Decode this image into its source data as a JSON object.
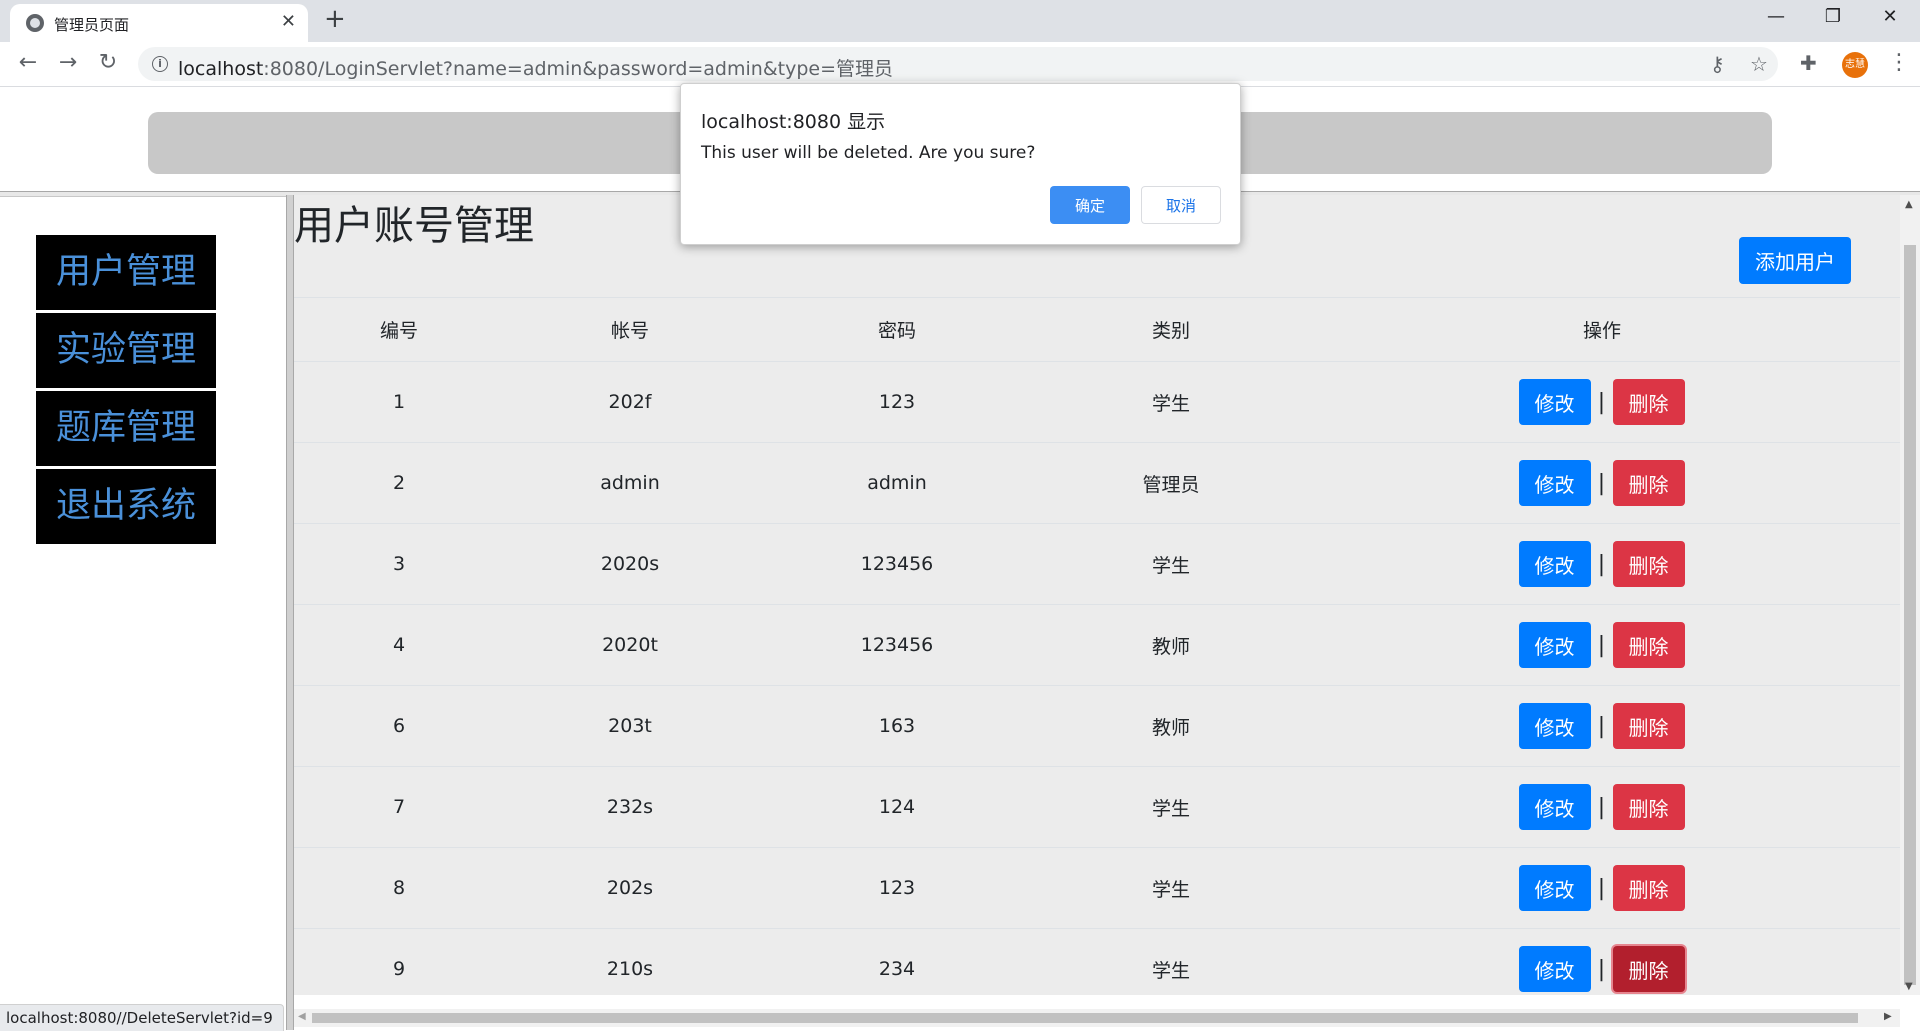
{
  "browser": {
    "tab_title": "管理员页面",
    "tab_close": "✕",
    "new_tab": "+",
    "url_host": "localhost",
    "url_rest": ":8080/LoginServlet?name=admin&password=admin&type=管理员",
    "avatar_text": "志慧",
    "icons": [
      "back-icon",
      "forward-icon",
      "reload-icon",
      "info-icon",
      "key-icon",
      "star-icon",
      "extensions-icon",
      "menu-icon"
    ]
  },
  "sidebar": {
    "items": [
      {
        "label": "用户管理"
      },
      {
        "label": "实验管理"
      },
      {
        "label": "题库管理"
      },
      {
        "label": "退出系统"
      }
    ],
    "text_color": "#4a90d9",
    "bg_color": "#000000"
  },
  "main": {
    "title": "用户账号管理",
    "add_button": "添加用户",
    "columns": [
      "编号",
      "帐号",
      "密码",
      "类别",
      "操作"
    ],
    "edit_label": "修改",
    "delete_label": "删除",
    "separator": "|",
    "rows": [
      {
        "id": "1",
        "account": "202f",
        "password": "123",
        "type": "学生"
      },
      {
        "id": "2",
        "account": "admin",
        "password": "admin",
        "type": "管理员"
      },
      {
        "id": "3",
        "account": "2020s",
        "password": "123456",
        "type": "学生"
      },
      {
        "id": "4",
        "account": "2020t",
        "password": "123456",
        "type": "教师"
      },
      {
        "id": "6",
        "account": "203t",
        "password": "163",
        "type": "教师"
      },
      {
        "id": "7",
        "account": "232s",
        "password": "124",
        "type": "学生"
      },
      {
        "id": "8",
        "account": "202s",
        "password": "123",
        "type": "学生"
      },
      {
        "id": "9",
        "account": "210s",
        "password": "234",
        "type": "学生"
      }
    ],
    "primary_color": "#007bff",
    "danger_color": "#dc3545"
  },
  "dialog": {
    "title": "localhost:8080 显示",
    "message": "This user will be deleted. Are you sure?",
    "ok_label": "确定",
    "cancel_label": "取消"
  },
  "status_bar": {
    "text": "localhost:8080//DeleteServlet?id=9"
  }
}
